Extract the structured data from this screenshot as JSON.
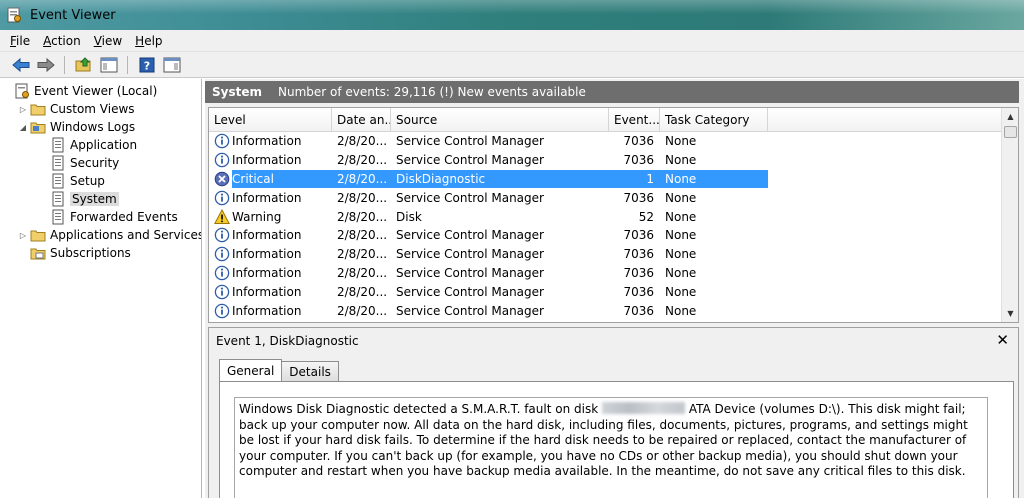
{
  "window": {
    "title": "Event Viewer"
  },
  "menu": {
    "items": [
      {
        "ul": "F",
        "rest": "ile"
      },
      {
        "ul": "A",
        "rest": "ction"
      },
      {
        "ul": "V",
        "rest": "iew"
      },
      {
        "ul": "H",
        "rest": "elp"
      }
    ]
  },
  "tree": {
    "root": "Event Viewer (Local)",
    "custom_views": "Custom Views",
    "windows_logs": "Windows Logs",
    "application": "Application",
    "security": "Security",
    "setup": "Setup",
    "system": "System",
    "forwarded_events": "Forwarded Events",
    "apps_services": "Applications and Services Lo",
    "subscriptions": "Subscriptions"
  },
  "log_header": {
    "name": "System",
    "summary": "Number of events: 29,116 (!) New events available"
  },
  "columns": [
    "Level",
    "Date an...",
    "Source",
    "Event...",
    "Task Category"
  ],
  "rows": [
    {
      "level": "Information",
      "icon": "info-icon",
      "date": "2/8/20...",
      "source": "Service Control Manager",
      "event_id": "7036",
      "task": "None"
    },
    {
      "level": "Information",
      "icon": "info-icon",
      "date": "2/8/20...",
      "source": "Service Control Manager",
      "event_id": "7036",
      "task": "None"
    },
    {
      "level": "Critical",
      "icon": "critical-icon",
      "date": "2/8/20...",
      "source": "DiskDiagnostic",
      "event_id": "1",
      "task": "None",
      "selected": true
    },
    {
      "level": "Information",
      "icon": "info-icon",
      "date": "2/8/20...",
      "source": "Service Control Manager",
      "event_id": "7036",
      "task": "None"
    },
    {
      "level": "Warning",
      "icon": "warning-icon",
      "date": "2/8/20...",
      "source": "Disk",
      "event_id": "52",
      "task": "None"
    },
    {
      "level": "Information",
      "icon": "info-icon",
      "date": "2/8/20...",
      "source": "Service Control Manager",
      "event_id": "7036",
      "task": "None"
    },
    {
      "level": "Information",
      "icon": "info-icon",
      "date": "2/8/20...",
      "source": "Service Control Manager",
      "event_id": "7036",
      "task": "None"
    },
    {
      "level": "Information",
      "icon": "info-icon",
      "date": "2/8/20...",
      "source": "Service Control Manager",
      "event_id": "7036",
      "task": "None"
    },
    {
      "level": "Information",
      "icon": "info-icon",
      "date": "2/8/20...",
      "source": "Service Control Manager",
      "event_id": "7036",
      "task": "None"
    },
    {
      "level": "Information",
      "icon": "info-icon",
      "date": "2/8/20...",
      "source": "Service Control Manager",
      "event_id": "7036",
      "task": "None"
    }
  ],
  "detail": {
    "title": "Event 1, DiskDiagnostic",
    "close": "✕",
    "tab_general": "General",
    "tab_details": "Details",
    "desc_before": "Windows Disk Diagnostic detected a S.M.A.R.T. fault on disk",
    "desc_after": "ATA Device (volumes D:\\).  This disk might fail; back up your computer now. All data on the hard disk, including files, documents, pictures, programs, and settings might be lost if your hard disk fails.  To determine if the hard disk needs to be repaired or replaced, contact the manufacturer of your computer.  If you can't back up (for example, you have no CDs or other backup media), you should shut down your computer and restart when you have backup media available.  In the meantime, do not save any critical files to this disk."
  },
  "colors": {
    "selection": "#3399ff",
    "header_bar": "#6e6e6e",
    "accent": "#2f7f7c"
  }
}
